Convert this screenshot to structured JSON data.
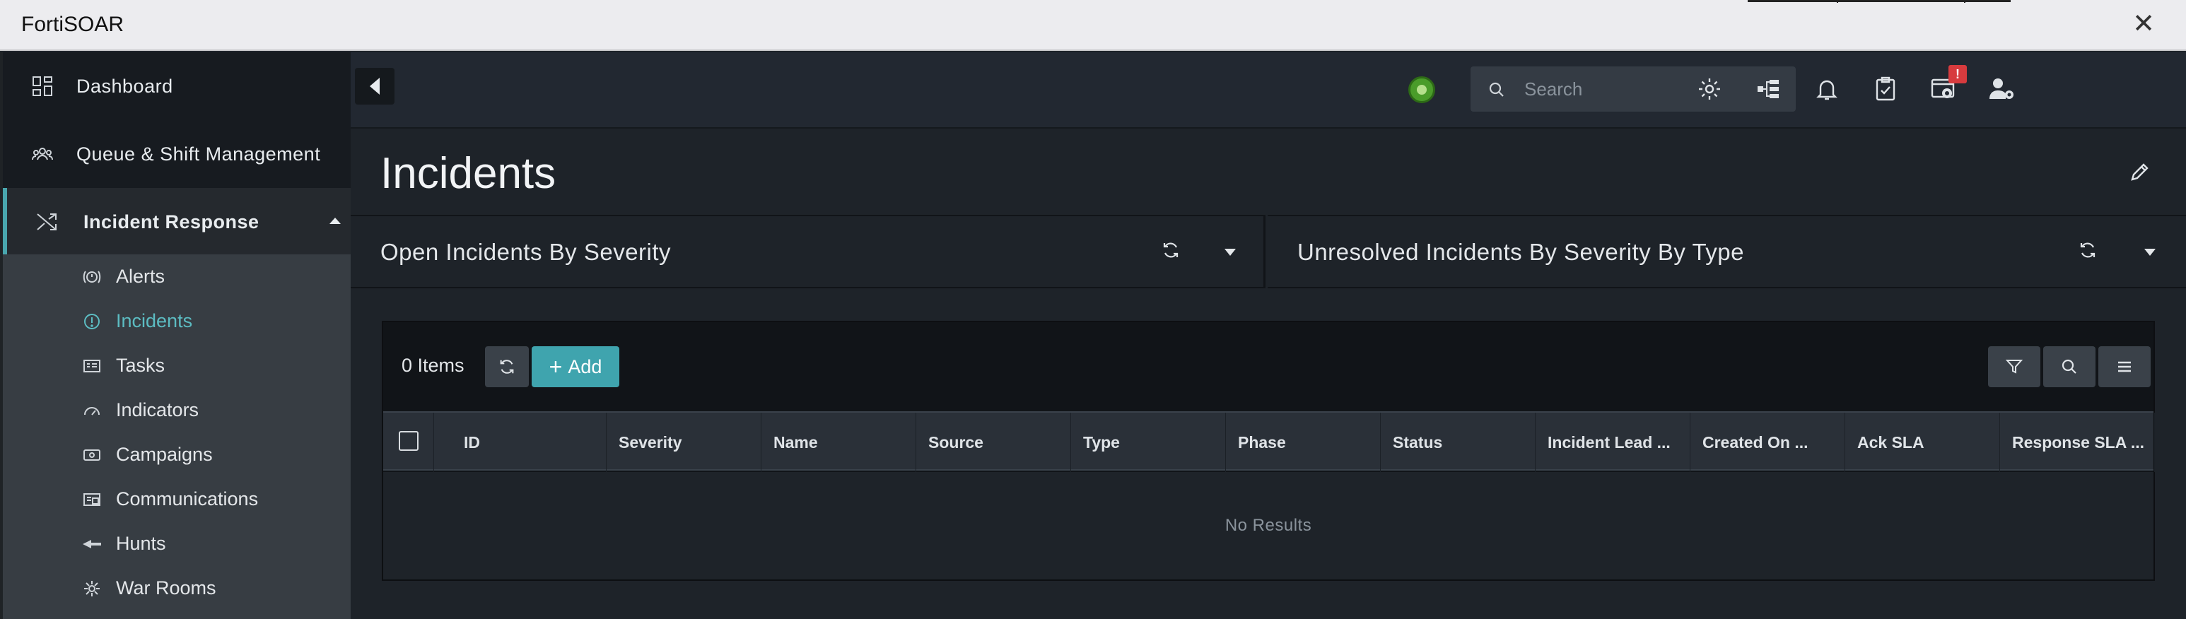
{
  "window": {
    "title": "FortiSOAR",
    "close_glyph": "✕"
  },
  "sidebar": {
    "items": [
      {
        "label": "Dashboard",
        "icon": "grid-icon"
      },
      {
        "label": "Queue & Shift Management",
        "icon": "users-icon"
      },
      {
        "label": "Incident Response",
        "icon": "shuffle-icon",
        "expanded": true
      }
    ],
    "subitems": [
      {
        "label": "Alerts",
        "icon": "alert-icon"
      },
      {
        "label": "Incidents",
        "icon": "incident-icon",
        "active": true
      },
      {
        "label": "Tasks",
        "icon": "tasks-icon"
      },
      {
        "label": "Indicators",
        "icon": "gauge-icon"
      },
      {
        "label": "Campaigns",
        "icon": "campaign-icon"
      },
      {
        "label": "Communications",
        "icon": "mail-icon"
      },
      {
        "label": "Hunts",
        "icon": "hunt-icon"
      },
      {
        "label": "War Rooms",
        "icon": "war-room-icon"
      }
    ]
  },
  "topbar": {
    "search_placeholder": "Search",
    "notification_badge": "!",
    "icons": [
      "settings-icon",
      "hierarchy-icon",
      "bell-icon",
      "clipboard-check-icon",
      "system-settings-icon",
      "user-settings-icon"
    ]
  },
  "page": {
    "title": "Incidents"
  },
  "widgets": [
    {
      "title": "Open Incidents By Severity"
    },
    {
      "title": "Unresolved Incidents By Severity By Type"
    }
  ],
  "grid": {
    "item_count": "0 Items",
    "add_label": "Add",
    "columns": [
      "ID",
      "Severity",
      "Name",
      "Source",
      "Type",
      "Phase",
      "Status",
      "Incident Lead ...",
      "Created On ...",
      "Ack SLA",
      "Response SLA ..."
    ],
    "empty_text": "No Results"
  },
  "colors": {
    "accent": "#3fa4ae",
    "active_text": "#5cbcc2",
    "badge": "#d73b3e",
    "status_ok": "#4a9c2a"
  }
}
